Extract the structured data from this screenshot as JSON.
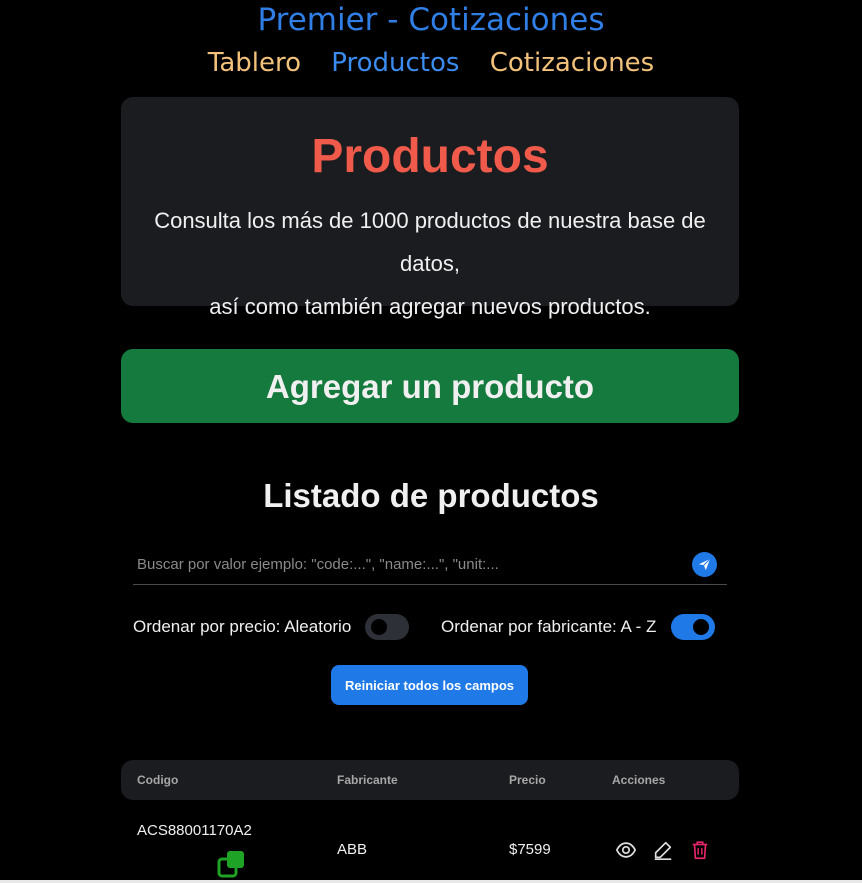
{
  "site": {
    "title": "Premier - Cotizaciones"
  },
  "nav": {
    "items": [
      {
        "label": "Tablero",
        "active": false
      },
      {
        "label": "Productos",
        "active": true
      },
      {
        "label": "Cotizaciones",
        "active": false
      }
    ]
  },
  "hero": {
    "title": "Productos",
    "description_line1": "Consulta los más de 1000 productos de nuestra base de datos,",
    "description_line2": "así como también agregar nuevos productos."
  },
  "add_button": {
    "label": "Agregar un producto"
  },
  "list": {
    "title": "Listado de productos",
    "search": {
      "value": "",
      "placeholder": "Buscar por valor ejemplo: \"code:...\", \"name:...\", \"unit:..."
    },
    "sort_price": {
      "label": "Ordenar por precio: Aleatorio",
      "enabled": false
    },
    "sort_manufacturer": {
      "label": "Ordenar por fabricante: A - Z",
      "enabled": true
    },
    "reset_button": "Reiniciar todos los campos"
  },
  "table": {
    "headers": [
      "Codigo",
      "Fabricante",
      "Precio",
      "Acciones"
    ],
    "rows": [
      {
        "code": "ACS88001170A2",
        "manufacturer": "ABB",
        "price": "$7599"
      }
    ]
  },
  "colors": {
    "accent_blue": "#1f7ae8",
    "nav_inactive": "#f2c27b",
    "hero_title": "#f05a4a",
    "add_green": "#157a3e",
    "delete_pink": "#e8266b",
    "copy_green": "#1fa326"
  },
  "icons": [
    "send-icon",
    "copy-icon",
    "view-icon",
    "edit-icon",
    "delete-icon"
  ]
}
